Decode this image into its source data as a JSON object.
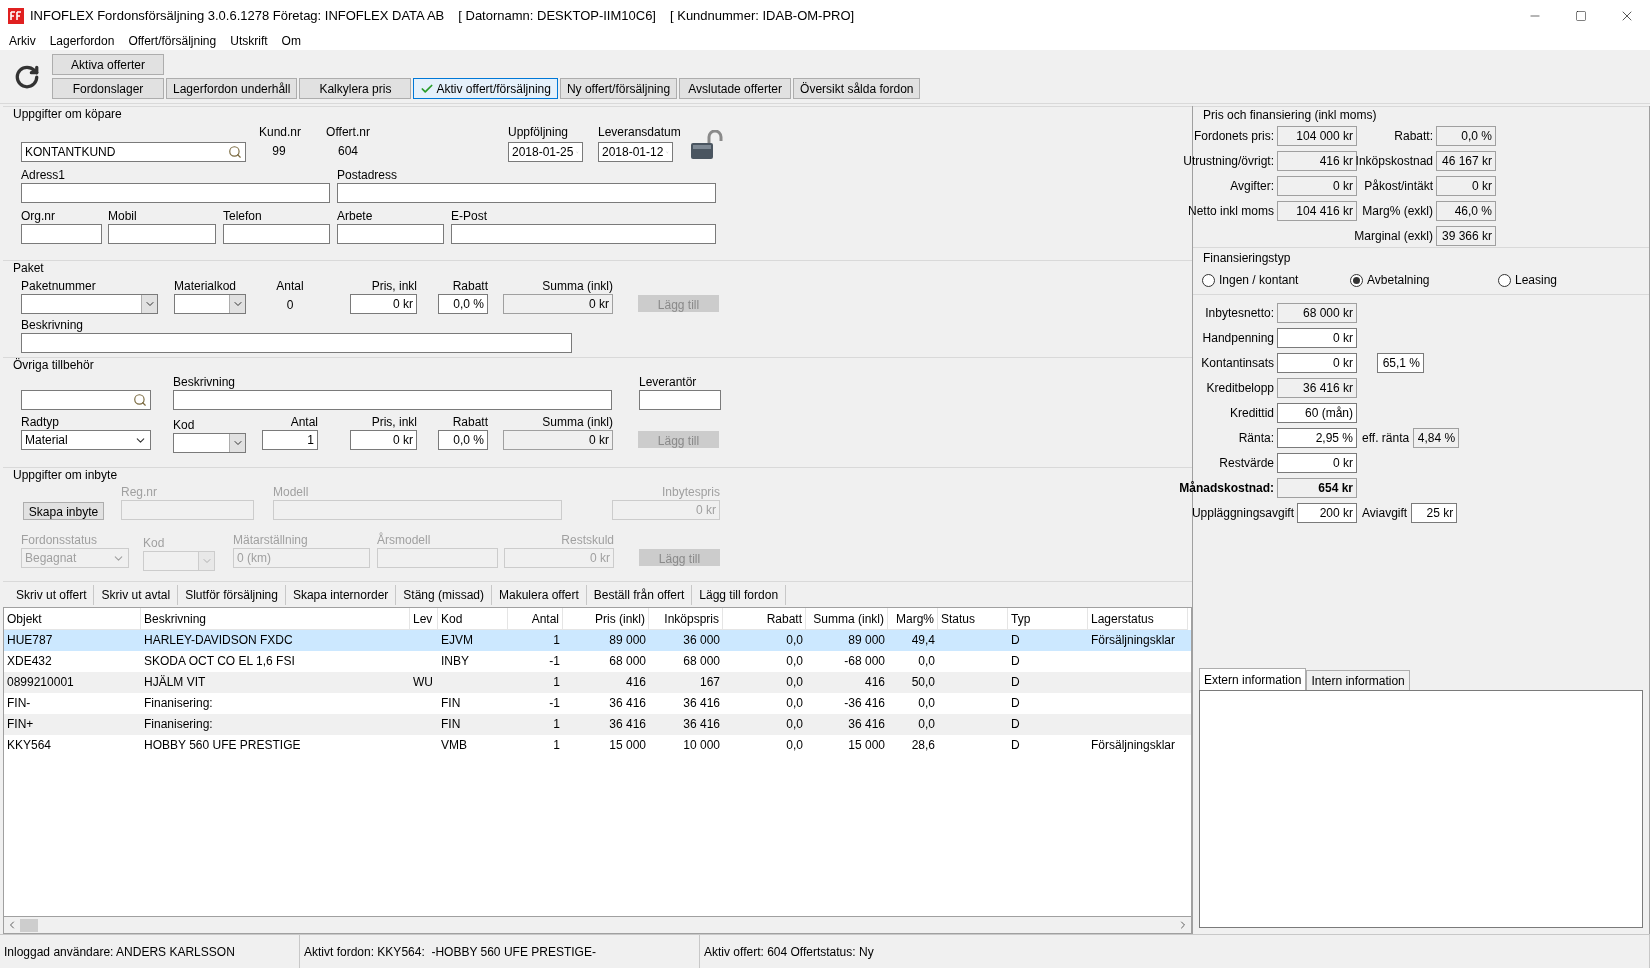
{
  "window": {
    "title": "INFOFLEX Fordonsförsäljning 3.0.6.1278 Företag: INFOFLEX DATA AB",
    "computer": "[ Datornamn: DESKTOP-IIM10C6]",
    "customer_no": "[ Kundnummer: IDAB-OM-PRO]"
  },
  "menu": [
    "Arkiv",
    "Lagerfordon",
    "Offert/försäljning",
    "Utskrift",
    "Om"
  ],
  "nav": {
    "top": [
      {
        "label": "Aktiva offerter",
        "selected": false
      }
    ],
    "buttons": [
      {
        "label": "Fordonslager",
        "selected": false
      },
      {
        "label": "Lagerfordon underhåll",
        "selected": false
      },
      {
        "label": "Kalkylera pris",
        "selected": false
      },
      {
        "label": "Aktiv offert/försäljning",
        "selected": true
      },
      {
        "label": "Ny offert/försäljning",
        "selected": false
      },
      {
        "label": "Avslutade offerter",
        "selected": false
      },
      {
        "label": "Översikt sålda fordon",
        "selected": false
      }
    ]
  },
  "buyer": {
    "title": "Uppgifter om köpare",
    "customer": {
      "value": "KONTANTKUND"
    },
    "kund_nr": {
      "label": "Kund.nr",
      "value": "99"
    },
    "offert_nr": {
      "label": "Offert.nr",
      "value": "604"
    },
    "uppfoljning": {
      "label": "Uppföljning",
      "value": "2018-01-25"
    },
    "leveransdatum": {
      "label": "Leveransdatum",
      "value": "2018-01-12"
    },
    "locked": false,
    "fields": [
      {
        "label": "Adress1"
      },
      {
        "label": "Postadress"
      },
      {
        "label": "Org.nr"
      },
      {
        "label": "Mobil"
      },
      {
        "label": "Telefon"
      },
      {
        "label": "Arbete"
      },
      {
        "label": "E-Post"
      }
    ]
  },
  "paket": {
    "title": "Paket",
    "paketnummer": {
      "label": "Paketnummer"
    },
    "materialkod": {
      "label": "Materialkod"
    },
    "antal": {
      "label": "Antal",
      "value": "0"
    },
    "pris": {
      "label": "Pris, inkl",
      "value": "0 kr"
    },
    "rabatt": {
      "label": "Rabatt",
      "value": "0,0 %"
    },
    "summa": {
      "label": "Summa (inkl)",
      "value": "0 kr"
    },
    "add": {
      "label": "Lägg till",
      "disabled": true
    },
    "beskrivning": {
      "label": "Beskrivning"
    }
  },
  "ovriga": {
    "title": "Övriga tillbehör",
    "beskrivning": {
      "label": "Beskrivning"
    },
    "leverantor": {
      "label": "Leverantör"
    },
    "radtyp": {
      "label": "Radtyp",
      "value": "Material"
    },
    "kod": {
      "label": "Kod"
    },
    "antal": {
      "label": "Antal",
      "value": "1"
    },
    "pris": {
      "label": "Pris, inkl",
      "value": "0 kr"
    },
    "rabatt": {
      "label": "Rabatt",
      "value": "0,0 %"
    },
    "summa": {
      "label": "Summa (inkl)",
      "value": "0 kr"
    },
    "add": {
      "label": "Lägg till",
      "disabled": true
    }
  },
  "inbyte": {
    "title": "Uppgifter om inbyte",
    "create": {
      "label": "Skapa inbyte",
      "disabled": false
    },
    "reg_nr": {
      "label": "Reg.nr",
      "disabled": true
    },
    "modell": {
      "label": "Modell",
      "disabled": true
    },
    "inbytespris": {
      "label": "Inbytespris",
      "value": "0 kr",
      "disabled": true
    },
    "fordonsstatus": {
      "label": "Fordonsstatus",
      "value": "Begagnat",
      "disabled": true
    },
    "kod": {
      "label": "Kod",
      "disabled": true
    },
    "matarstallning": {
      "label": "Mätarställning",
      "value": "0 (km)",
      "disabled": true
    },
    "arsmodell": {
      "label": "Årsmodell",
      "disabled": true
    },
    "restskuld": {
      "label": "Restskuld",
      "value": "0 kr",
      "disabled": true
    },
    "add": {
      "label": "Lägg till",
      "disabled": true
    }
  },
  "pricing": {
    "title": "Pris och finansiering (inkl moms)",
    "left": [
      {
        "label": "Fordonets pris:",
        "value": "104 000 kr"
      },
      {
        "label": "Utrustning/övrigt:",
        "value": "416 kr"
      },
      {
        "label": "Avgifter:",
        "value": "0 kr"
      },
      {
        "label": "Netto inkl moms",
        "value": "104 416 kr"
      }
    ],
    "right": [
      {
        "label": "Rabatt:",
        "value": "0,0 %"
      },
      {
        "label": "Inköpskostnad",
        "value": "46 167 kr"
      },
      {
        "label": "Påkost/intäkt",
        "value": "0 kr"
      },
      {
        "label": "Marg% (exkl)",
        "value": "46,0 %"
      },
      {
        "label": "Marginal (exkl)",
        "value": "39 366 kr"
      }
    ]
  },
  "financing": {
    "title": "Finansieringstyp",
    "options": [
      {
        "label": "Ingen / kontant",
        "selected": false
      },
      {
        "label": "Avbetalning",
        "selected": true
      },
      {
        "label": "Leasing",
        "selected": false
      }
    ]
  },
  "credit": [
    {
      "label": "Inbytesnetto:",
      "value": "68 000 kr",
      "kind": "readout"
    },
    {
      "label": "Handpenning",
      "value": "0 kr",
      "kind": "input"
    },
    {
      "label": "Kontantinsats",
      "value": "0 kr",
      "kind": "input",
      "extra": {
        "value": "65,1 %",
        "kind": "input"
      }
    },
    {
      "label": "Kreditbelopp",
      "value": "36 416 kr",
      "kind": "readout"
    },
    {
      "label": "Kredittid",
      "value": "60 (mån)",
      "kind": "input"
    },
    {
      "label": "Ränta:",
      "value": "2,95 %",
      "kind": "input",
      "extra": {
        "label": "eff. ränta",
        "value": "4,84 %",
        "kind": "readout"
      }
    },
    {
      "label": "Restvärde",
      "value": "0 kr",
      "kind": "input"
    },
    {
      "label": "Månadskostnad:",
      "value": "654 kr",
      "kind": "total"
    },
    {
      "label": "Uppläggningsavgift",
      "value": "200 kr",
      "kind": "input",
      "extra": {
        "label": "Aviavgift",
        "value": "25 kr",
        "kind": "input"
      }
    }
  ],
  "actions": [
    "Skriv ut offert",
    "Skriv ut avtal",
    "Slutför försäljning",
    "Skapa internorder",
    "Stäng (missad)",
    "Makulera offert",
    "Beställ från offert",
    "Lägg till fordon"
  ],
  "table": {
    "columns": [
      "Objekt",
      "Beskrivning",
      "Lev",
      "Kod",
      "Antal",
      "Pris (inkl)",
      "Inköpspris",
      "Rabatt",
      "Summa (inkl)",
      "Marg%",
      "Status",
      "Typ",
      "Lagerstatus"
    ],
    "rows": [
      {
        "selected": true,
        "cells": [
          "HUE787",
          "HARLEY-DAVIDSON FXDC",
          null,
          "EJVM",
          "1",
          "89 000",
          "36 000",
          "0,0",
          "89 000",
          "49,4",
          null,
          "D",
          "Försäljningsklar"
        ]
      },
      {
        "selected": false,
        "cells": [
          "XDE432",
          "SKODA OCT CO EL 1,6 FSI",
          null,
          "INBY",
          "-1",
          "68 000",
          "68 000",
          "0,0",
          "-68 000",
          "0,0",
          null,
          "D",
          null
        ]
      },
      {
        "selected": false,
        "cells": [
          "0899210001",
          "HJÄLM VIT",
          "WU",
          null,
          "1",
          "416",
          "167",
          "0,0",
          "416",
          "50,0",
          null,
          "D",
          null
        ]
      },
      {
        "selected": false,
        "cells": [
          "FIN-",
          "Finanisering:",
          null,
          "FIN",
          "-1",
          "36 416",
          "36 416",
          "0,0",
          "-36 416",
          "0,0",
          null,
          "D",
          null
        ]
      },
      {
        "selected": false,
        "cells": [
          "FIN+",
          "Finanisering:",
          null,
          "FIN",
          "1",
          "36 416",
          "36 416",
          "0,0",
          "36 416",
          "0,0",
          null,
          "D",
          null
        ]
      },
      {
        "selected": false,
        "cells": [
          "KKY564",
          "HOBBY 560 UFE PRESTIGE",
          null,
          "VMB",
          "1",
          "15 000",
          "10 000",
          "0,0",
          "15 000",
          "28,6",
          null,
          "D",
          "Försäljningsklar"
        ]
      }
    ]
  },
  "info_tabs": [
    {
      "label": "Extern information",
      "selected": true
    },
    {
      "label": "Intern information",
      "selected": false
    }
  ],
  "status_bar": [
    "Inloggad användare: ANDERS KARLSSON",
    "Aktivt fordon: KKY564:  -HOBBY 560 UFE PRESTIGE-",
    "Aktiv offert: 604 Offertstatus: Ny"
  ]
}
